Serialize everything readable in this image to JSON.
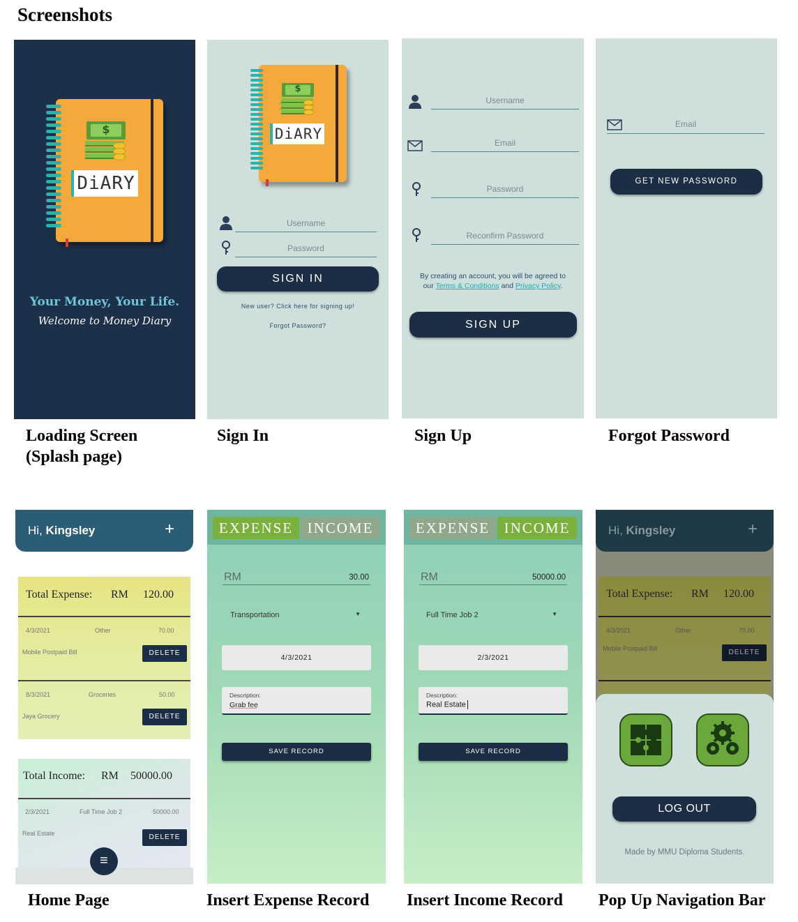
{
  "page_title": "Screenshots",
  "captions": {
    "loading": [
      "Loading Screen",
      "(Splash page)"
    ],
    "signin": "Sign In",
    "signup": "Sign Up",
    "forgot": "Forgot Password",
    "home": "Home Page",
    "expense": "Insert Expense Record",
    "income": "Insert Income Record",
    "popup": "Pop Up Navigation Bar"
  },
  "notebook": {
    "label": "DiARY",
    "symbol": "$"
  },
  "splash": {
    "tagline": "Your Money, Your Life.",
    "welcome": "Welcome to Money Diary"
  },
  "signin": {
    "username_placeholder": "Username",
    "password_placeholder": "Password",
    "button": "SIGN IN",
    "new_user": "New user? Click here for signing up!",
    "forgot": "Forgot Password?"
  },
  "signup": {
    "username_placeholder": "Username",
    "email_placeholder": "Email",
    "password_placeholder": "Password",
    "reconfirm_placeholder": "Reconfirm Password",
    "agree_prefix": "By creating an account, you will be agreed to",
    "agree_our": "our",
    "terms": "Terms & Conditions",
    "and": "and",
    "privacy": "Privacy Policy",
    "period": ".",
    "button": "SIGN UP"
  },
  "forgot": {
    "email_placeholder": "Email",
    "button": "GET NEW PASSWORD"
  },
  "home": {
    "greeting_hi": "Hi,",
    "user": "Kingsley",
    "add_icon": "+",
    "expense_label": "Total Expense:",
    "currency": "RM",
    "expense_total": "120.00",
    "expenses": [
      {
        "date": "4/3/2021",
        "category": "Other",
        "amount": "70.00",
        "desc": "Mobile Postpaid Bill"
      },
      {
        "date": "8/3/2021",
        "category": "Groceries",
        "amount": "50.00",
        "desc": "Jaya Grocery"
      }
    ],
    "income_label": "Total Income:",
    "income_total": "50000.00",
    "incomes": [
      {
        "date": "2/3/2021",
        "category": "Full Time Job 2",
        "amount": "50000.00",
        "desc": "Real Estate"
      }
    ],
    "delete_label": "DELETE",
    "menu_icon": "≡"
  },
  "expense_form": {
    "tab_expense": "EXPENSE",
    "tab_income": "INCOME",
    "currency": "RM",
    "amount": "30.00",
    "category": "Transportation",
    "date": "4/3/2021",
    "desc_label": "Description:",
    "desc_value": "Grab fee",
    "save": "SAVE RECORD",
    "colors": {
      "active": "#7ab03c",
      "inactive": "#8fa88a"
    }
  },
  "income_form": {
    "tab_expense": "EXPENSE",
    "tab_income": "INCOME",
    "currency": "RM",
    "amount": "50000.00",
    "category": "Full Time Job 2",
    "date": "2/3/2021",
    "desc_label": "Description:",
    "desc_value": "Real Estate",
    "save": "SAVE RECORD"
  },
  "popup": {
    "greeting_hi": "Hi,",
    "user": "Kingsley",
    "add_icon": "+",
    "expense_label": "Total Expense:",
    "currency": "RM",
    "expense_total": "120.00",
    "row_date": "4/3/2021",
    "row_category": "Other",
    "row_amount": "70.00",
    "row_desc": "Mobile Postpaid Bill",
    "delete_label": "DELETE",
    "logout": "LOG OUT",
    "footer": "Made by MMU Diploma Students."
  },
  "colors": {
    "navy": "#1c2e45",
    "splash_bg": "#1c3049",
    "mint_bg": "#cfe0dc",
    "teal_bar": "#2b5d77",
    "link": "#1aa9c7",
    "puzzle_green": "#6aa83c"
  }
}
